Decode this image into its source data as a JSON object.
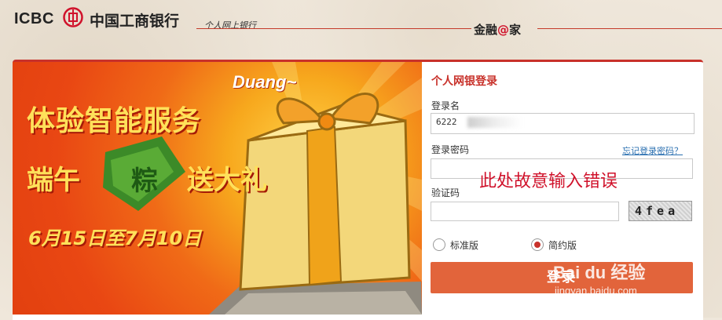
{
  "header": {
    "logo_text": "ICBC",
    "bank_name": "中国工商银行",
    "subtitle": "个人网上银行",
    "slogan_prefix": "金融",
    "slogan_at": "@",
    "slogan_suffix": "家"
  },
  "banner": {
    "line1": "体验智能服务",
    "line2_left": "端午",
    "line2_mid": "粽",
    "line2_right": "送大礼",
    "dates": "6月15日至7月10日",
    "duang": "Duang~"
  },
  "login": {
    "title": "个人网银登录",
    "username_label": "登录名",
    "username_value": "6222",
    "password_label": "登录密码",
    "forgot_link": "忘记登录密码？",
    "password_annotation": "此处故意输入错误",
    "captcha_label": "验证码",
    "captcha_text": "4fea",
    "edition_standard": "标准版",
    "edition_simple": "简约版",
    "selected_edition": "简约版",
    "submit_label": "登录"
  },
  "watermark": {
    "brand": "Bai du 经验",
    "url": "jingyan.baidu.com"
  },
  "colors": {
    "accent_red": "#c8312a",
    "button": "#e2643b",
    "link": "#2a6fb0"
  }
}
